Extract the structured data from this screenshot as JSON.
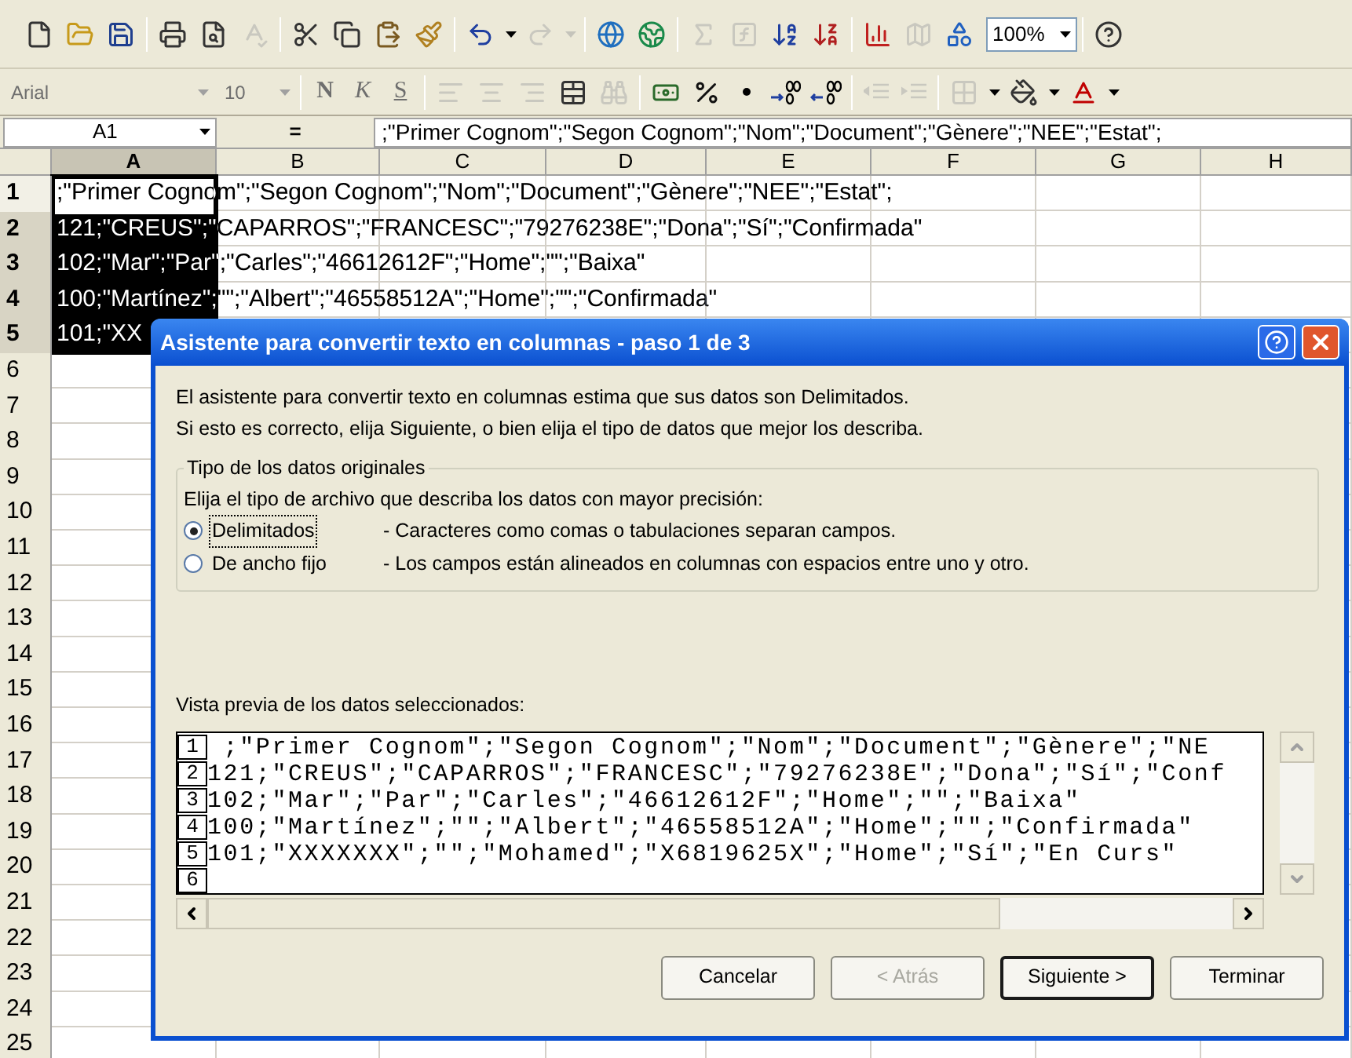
{
  "standard_toolbar": [
    {
      "kind": "new",
      "disabled": false
    },
    {
      "kind": "open",
      "disabled": false
    },
    {
      "kind": "save",
      "disabled": false
    },
    {
      "kind": "separator"
    },
    {
      "kind": "print",
      "disabled": false
    },
    {
      "kind": "preview",
      "disabled": false
    },
    {
      "kind": "spelling",
      "disabled": true
    },
    {
      "kind": "separator"
    },
    {
      "kind": "cut",
      "disabled": false
    },
    {
      "kind": "copy",
      "disabled": false
    },
    {
      "kind": "paste",
      "disabled": false
    },
    {
      "kind": "format_painter",
      "disabled": false
    },
    {
      "kind": "separator"
    },
    {
      "kind": "undo",
      "disabled": false
    },
    {
      "kind": "dropdown",
      "disabled": false
    },
    {
      "kind": "redo",
      "disabled": true
    },
    {
      "kind": "dropdown",
      "disabled": true
    },
    {
      "kind": "separator"
    },
    {
      "kind": "hyperlink",
      "disabled": false
    },
    {
      "kind": "web",
      "disabled": false
    },
    {
      "kind": "separator"
    },
    {
      "kind": "autosum",
      "disabled": true
    },
    {
      "kind": "function",
      "disabled": true
    },
    {
      "kind": "sort_asc",
      "disabled": false
    },
    {
      "kind": "sort_desc",
      "disabled": false
    },
    {
      "kind": "separator"
    },
    {
      "kind": "chart",
      "disabled": false
    },
    {
      "kind": "map",
      "disabled": true
    },
    {
      "kind": "drawing",
      "disabled": false
    },
    {
      "kind": "zoom",
      "disabled": false,
      "label": "100%"
    },
    {
      "kind": "separator"
    },
    {
      "kind": "help",
      "disabled": false
    }
  ],
  "formatting_toolbar": [
    {
      "kind": "font",
      "disabled": true,
      "label": "Arial"
    },
    {
      "kind": "size",
      "disabled": true,
      "label": "10"
    },
    {
      "kind": "separator"
    },
    {
      "kind": "bold",
      "disabled": true,
      "label": "N"
    },
    {
      "kind": "italic",
      "disabled": true,
      "label": "K"
    },
    {
      "kind": "underline",
      "disabled": true,
      "label": "S"
    },
    {
      "kind": "separator"
    },
    {
      "kind": "align_left",
      "disabled": true
    },
    {
      "kind": "align_center",
      "disabled": true
    },
    {
      "kind": "align_right",
      "disabled": true
    },
    {
      "kind": "merge",
      "disabled": false
    },
    {
      "kind": "find",
      "disabled": true
    },
    {
      "kind": "separator"
    },
    {
      "kind": "currency",
      "disabled": false
    },
    {
      "kind": "percent",
      "disabled": false
    },
    {
      "kind": "thousands",
      "disabled": false
    },
    {
      "kind": "inc_decimal",
      "disabled": false
    },
    {
      "kind": "dec_decimal",
      "disabled": false
    },
    {
      "kind": "separator"
    },
    {
      "kind": "outdent",
      "disabled": true
    },
    {
      "kind": "indent",
      "disabled": true
    },
    {
      "kind": "separator"
    },
    {
      "kind": "borders",
      "disabled": true
    },
    {
      "kind": "dropdown",
      "disabled": false
    },
    {
      "kind": "fill",
      "disabled": false
    },
    {
      "kind": "dropdown",
      "disabled": false
    },
    {
      "kind": "font_color",
      "disabled": false
    },
    {
      "kind": "dropdown",
      "disabled": false
    }
  ],
  "formula_bar": {
    "name_box": "A1",
    "equals": "=",
    "formula": ";\"Primer Cognom\";\"Segon Cognom\";\"Nom\";\"Document\";\"Gènere\";\"NEE\";\"Estat\";"
  },
  "columns": [
    {
      "label": "A",
      "selected": true
    },
    {
      "label": "B",
      "selected": false
    },
    {
      "label": "C",
      "selected": false
    },
    {
      "label": "D",
      "selected": false
    },
    {
      "label": "E",
      "selected": false
    },
    {
      "label": "F",
      "selected": false
    },
    {
      "label": "G",
      "selected": false
    },
    {
      "label": "H",
      "selected": false
    }
  ],
  "rows": [
    {
      "number": "1",
      "text": ";\"Primer Cognom\";\"Segon Cognom\";\"Nom\";\"Document\";\"Gènere\";\"NEE\";\"Estat\";",
      "selected": true,
      "active": true
    },
    {
      "number": "2",
      "text": "121;\"CREUS\";\"CAPARROS\";\"FRANCESC\";\"79276238E\";\"Dona\";\"Sí\";\"Confirmada\"",
      "selected": true,
      "active": false
    },
    {
      "number": "3",
      "text": "102;\"Mar\";\"Par\";\"Carles\";\"46612612F\";\"Home\";\"\";\"Baixa\"",
      "selected": true,
      "active": false
    },
    {
      "number": "4",
      "text": "100;\"Martínez\";\"\";\"Albert\";\"46558512A\";\"Home\";\"\";\"Confirmada\"",
      "selected": true,
      "active": false
    },
    {
      "number": "5",
      "text": "101;\"XX",
      "selected": true,
      "active": false
    },
    {
      "number": "6",
      "selected": false
    },
    {
      "number": "7",
      "selected": false
    },
    {
      "number": "8",
      "selected": false
    },
    {
      "number": "9",
      "selected": false
    },
    {
      "number": "10",
      "selected": false
    },
    {
      "number": "11",
      "selected": false
    },
    {
      "number": "12",
      "selected": false
    },
    {
      "number": "13",
      "selected": false
    },
    {
      "number": "14",
      "selected": false
    },
    {
      "number": "15",
      "selected": false
    },
    {
      "number": "16",
      "selected": false
    },
    {
      "number": "17",
      "selected": false
    },
    {
      "number": "18",
      "selected": false
    },
    {
      "number": "19",
      "selected": false
    },
    {
      "number": "20",
      "selected": false
    },
    {
      "number": "21",
      "selected": false
    },
    {
      "number": "22",
      "selected": false
    },
    {
      "number": "23",
      "selected": false
    },
    {
      "number": "24",
      "selected": false
    },
    {
      "number": "25",
      "selected": false
    }
  ],
  "dialog": {
    "title": "Asistente para convertir texto en columnas - paso 1 de 3",
    "intro": [
      "El asistente para convertir texto en columnas estima que sus datos son Delimitados.",
      "Si esto es correcto, elija Siguiente, o bien elija el tipo de datos que mejor los describa."
    ],
    "group": {
      "title": "Tipo de los datos originales",
      "instruction": "Elija el tipo de archivo que describa los datos con mayor precisión:",
      "options": [
        {
          "label": "Delimitados",
          "description": "- Caracteres como comas o tabulaciones separan campos.",
          "selected": true
        },
        {
          "label": "De ancho fijo",
          "description": "- Los campos están alineados en columnas con espacios entre uno y otro.",
          "selected": false
        }
      ]
    },
    "preview_label": "Vista previa de los datos seleccionados:",
    "preview_lines": [
      {
        "number": "1",
        "text": " ;\"Primer Cognom\";\"Segon Cognom\";\"Nom\";\"Document\";\"Gènere\";\"NE"
      },
      {
        "number": "2",
        "text": "121;\"CREUS\";\"CAPARROS\";\"FRANCESC\";\"79276238E\";\"Dona\";\"Sí\";\"Conf"
      },
      {
        "number": "3",
        "text": "102;\"Mar\";\"Par\";\"Carles\";\"46612612F\";\"Home\";\"\";\"Baixa\""
      },
      {
        "number": "4",
        "text": "100;\"Martínez\";\"\";\"Albert\";\"46558512A\";\"Home\";\"\";\"Confirmada\""
      },
      {
        "number": "5",
        "text": "101;\"XXXXXXX\";\"\";\"Mohamed\";\"X6819625X\";\"Home\";\"Sí\";\"En Curs\""
      },
      {
        "number": "6"
      }
    ],
    "buttons": [
      {
        "label": "Cancelar",
        "disabled": false,
        "default": false
      },
      {
        "label": "< Atrás",
        "disabled": true,
        "default": false
      },
      {
        "label": "Siguiente >",
        "disabled": false,
        "default": true
      },
      {
        "label": "Terminar",
        "disabled": false,
        "default": false
      }
    ]
  }
}
